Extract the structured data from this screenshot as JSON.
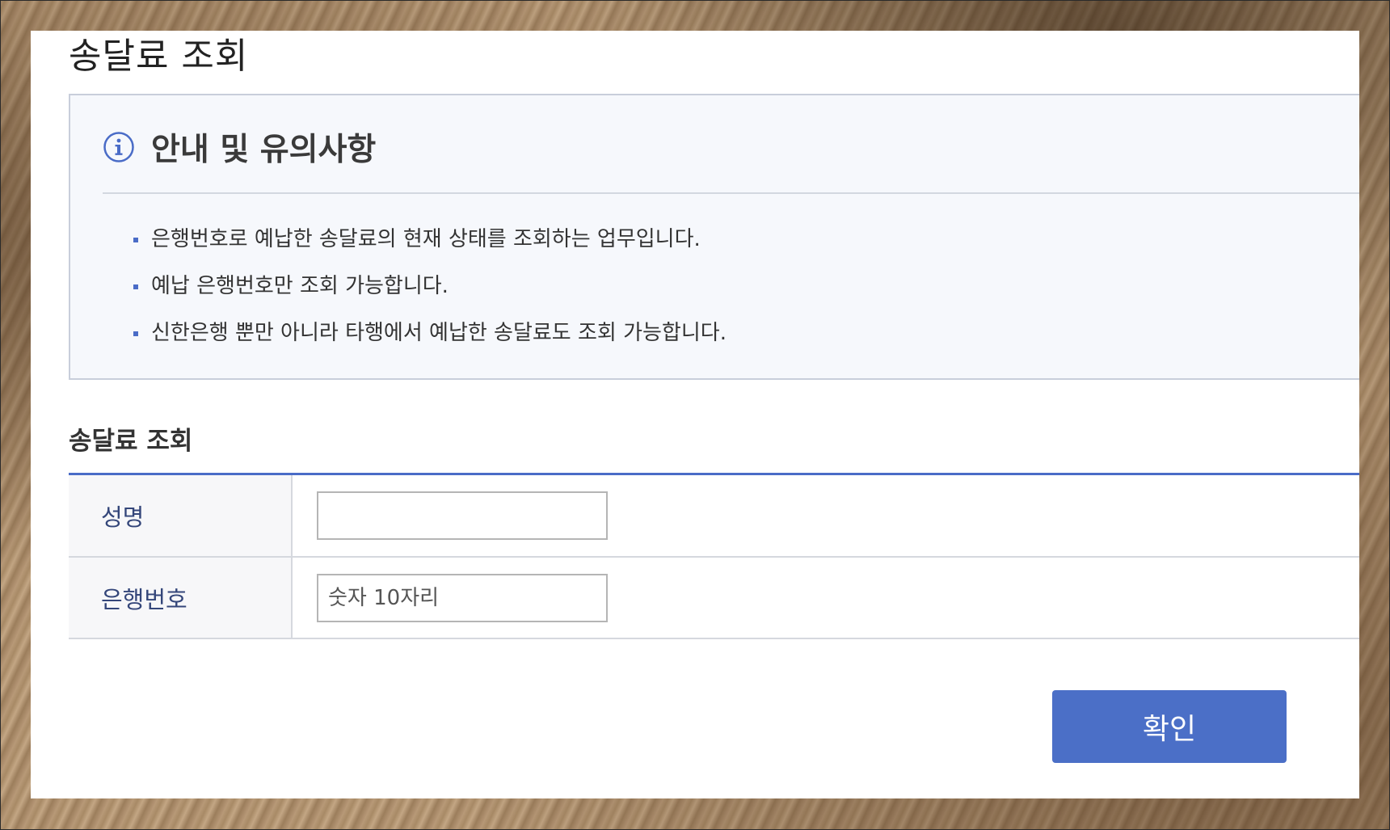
{
  "page": {
    "title": "송달료 조회"
  },
  "notice": {
    "title": "안내 및 유의사항",
    "icon": "info-icon",
    "items": [
      "은행번호로 예납한 송달료의 현재 상태를 조회하는 업무입니다.",
      "예납 은행번호만 조회 가능합니다.",
      "신한은행 뿐만 아니라 타행에서 예납한 송달료도 조회 가능합니다."
    ]
  },
  "form": {
    "title": "송달료 조회",
    "name_label": "성명",
    "name_value": "",
    "name_placeholder": "",
    "bank_label": "은행번호",
    "bank_value": "",
    "bank_placeholder": "숫자 10자리",
    "confirm_label": "확인"
  },
  "colors": {
    "accent": "#4b6fc7",
    "label_text": "#34467a",
    "notice_bg": "#f6f8fc"
  }
}
